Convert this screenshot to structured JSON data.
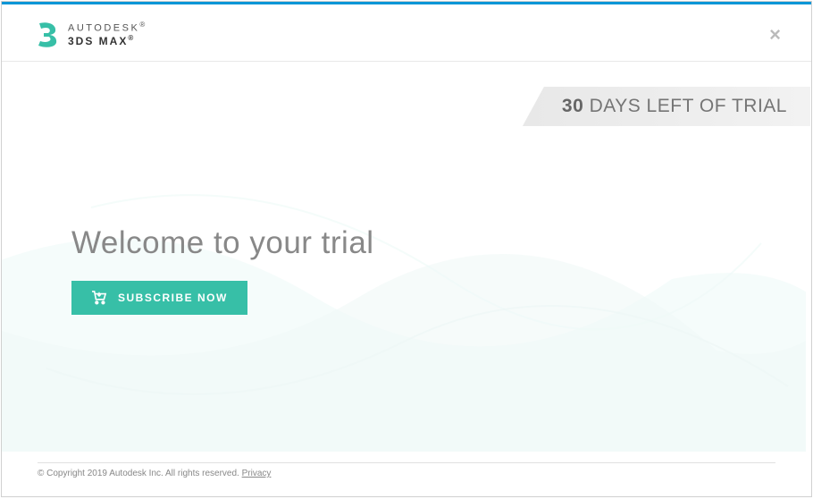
{
  "header": {
    "brand_line1": "AUTODESK",
    "brand_line2": "3DS MAX",
    "reg_symbol": "®"
  },
  "trial_banner": {
    "days": "30",
    "text": " DAYS LEFT OF TRIAL"
  },
  "main": {
    "heading": "Welcome to your trial",
    "subscribe_label": "SUBSCRIBE NOW"
  },
  "footer": {
    "copyright": "© Copyright 2019 Autodesk Inc. All rights reserved. ",
    "privacy_label": "Privacy"
  },
  "colors": {
    "accent_top": "#0696d7",
    "button_bg": "#37bfa7",
    "logo_teal": "#37bfa7"
  }
}
